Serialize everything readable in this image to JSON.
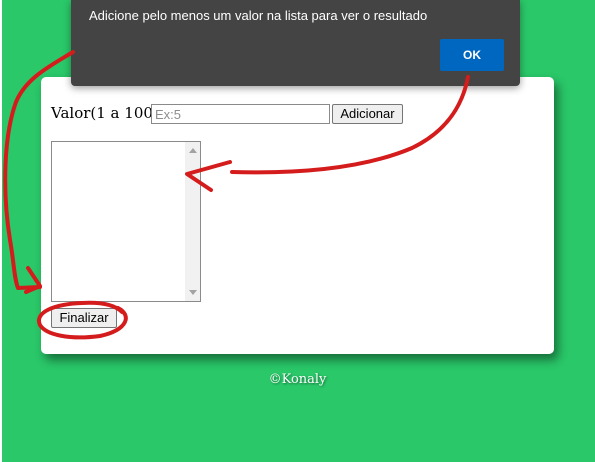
{
  "dialog": {
    "message": "Adicione pelo menos um valor na lista para ver o resultado",
    "ok_label": "OK"
  },
  "form": {
    "value_label": "Valor(1 a 100):",
    "input_placeholder": "Ex:5",
    "input_value": "",
    "add_label": "Adicionar",
    "finish_label": "Finalizar"
  },
  "footer": {
    "credit": "©Konaly"
  },
  "colors": {
    "background": "#2ac869",
    "dialog": "#444444",
    "ok_button": "#0067c0",
    "annotation": "#d41c1c"
  }
}
